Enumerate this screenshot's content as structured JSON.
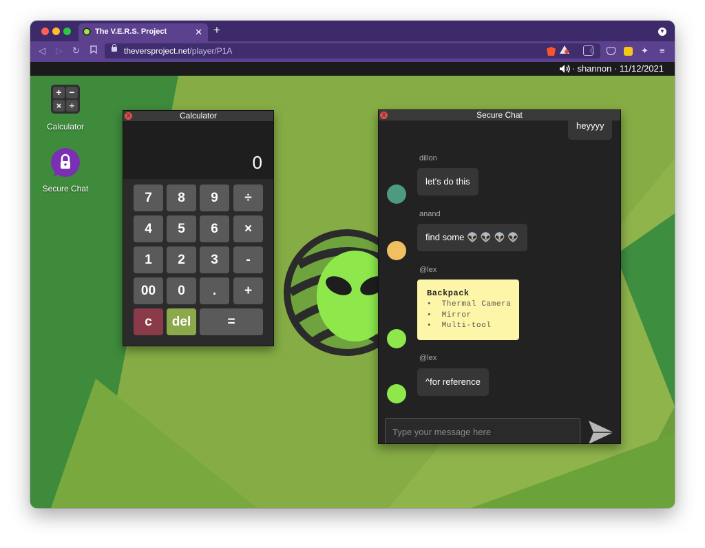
{
  "browser": {
    "tab_title": "The V.E.R.S. Project",
    "tab_close": "✕",
    "new_tab": "+",
    "url_host": "theversproject.net",
    "url_path": "/player/P1A"
  },
  "panel": {
    "status_text": "· shannon · 11/12/2021"
  },
  "desktop_icons": [
    {
      "label": "Calculator",
      "icon": "calculator-icon"
    },
    {
      "label": "Secure Chat",
      "icon": "lock-chat-icon"
    }
  ],
  "calculator": {
    "title": "Calculator",
    "close_label": "X",
    "display": "0",
    "keys": [
      [
        "7",
        "8",
        "9",
        "÷"
      ],
      [
        "4",
        "5",
        "6",
        "×"
      ],
      [
        "1",
        "2",
        "3",
        "-"
      ],
      [
        "00",
        "0",
        ".",
        "+"
      ],
      [
        "c",
        "del",
        "="
      ]
    ],
    "colors": {
      "clear": "#8b3a4a",
      "del": "#8ba84a",
      "key": "#5a5a5a"
    }
  },
  "chat": {
    "title": "Secure Chat",
    "close_label": "X",
    "messages": [
      {
        "sender": "",
        "text": "heyyyy",
        "own": true
      },
      {
        "sender": "dillon",
        "text": "let's do this",
        "avatar_color": "#4e9a7e"
      },
      {
        "sender": "anand",
        "text": "find some 👽 👽 👽 👽",
        "avatar_color": "#f0c060"
      },
      {
        "sender": "@lex",
        "note": {
          "title": "Backpack",
          "items": [
            "Thermal Camera",
            "Mirror",
            "Multi-tool"
          ]
        },
        "avatar_color": "#8ee84c"
      },
      {
        "sender": "@lex",
        "text": "^for reference",
        "avatar_color": "#8ee84c"
      }
    ],
    "input_placeholder": "Type your message here",
    "send_icon": "send-icon"
  },
  "colors": {
    "tabbar": "#3d2a6b",
    "navbar": "#5c418f",
    "accent_green": "#8ee84c"
  }
}
